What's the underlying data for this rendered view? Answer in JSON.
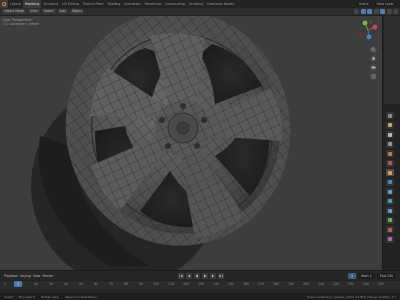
{
  "topbar": {
    "tabs": [
      "Layout",
      "Modeling",
      "Sculpting",
      "UV Editing",
      "Texture Paint",
      "Shading",
      "Animation",
      "Rendering",
      "Compositing",
      "Scripting",
      "Geometry Nodes"
    ],
    "active_tab": 1,
    "scene_label": "Scene",
    "view_layer_label": "View Layer"
  },
  "viewport_header": {
    "mode": "Object Mode",
    "view": "View",
    "select": "Select",
    "add": "Add",
    "object": "Object"
  },
  "viewport": {
    "overlay_title": "User Perspective",
    "overlay_subtitle": "(1) Collection | wheel"
  },
  "timeline": {
    "playback": "Playback",
    "keying": "Keying",
    "view": "View",
    "marker": "Marker",
    "current_frame": "1",
    "start": "Start 1",
    "end": "End 250",
    "ticks": [
      "0",
      "10",
      "20",
      "30",
      "40",
      "50",
      "60",
      "70",
      "80",
      "90",
      "100",
      "110",
      "120",
      "130",
      "140",
      "150",
      "160",
      "170",
      "180",
      "190",
      "200",
      "210",
      "220",
      "230",
      "240",
      "250"
    ]
  },
  "status": {
    "select": "Select",
    "box_select": "Box Select",
    "rotate": "Rotate View",
    "context": "Object Context Menu",
    "stats": "Scene Collection | wheel | Verts 23,816 | Faces 23,936 | 3.x"
  },
  "colors": {
    "accent": "#4a78b5",
    "x_axis": "#d4414e",
    "y_axis": "#7fb339",
    "z_axis": "#3f86d6"
  }
}
